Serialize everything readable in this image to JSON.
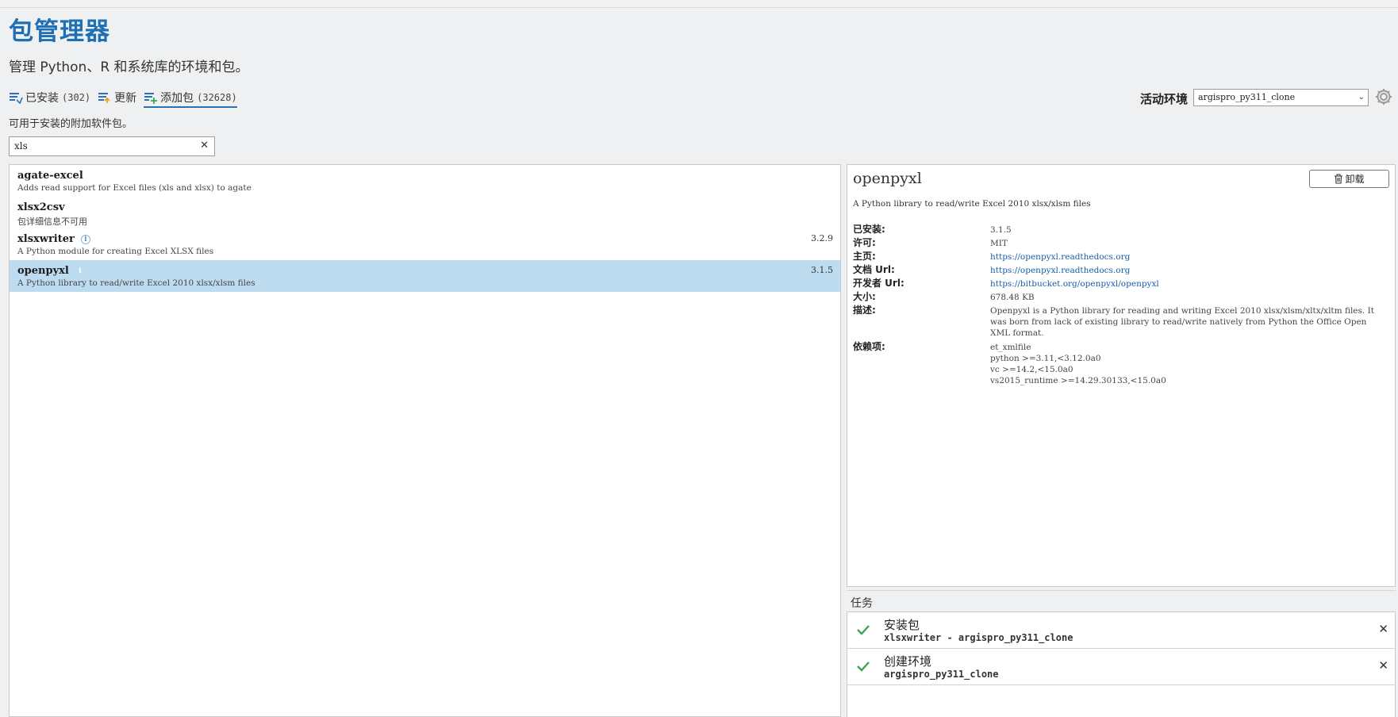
{
  "page": {
    "title": "包管理器",
    "subtitle": "管理 Python、R 和系统库的环境和包。"
  },
  "tabs": [
    {
      "label": "已安装",
      "count": "(302)",
      "icon": "installed-list-icon"
    },
    {
      "label": "更新",
      "count": "",
      "icon": "update-list-icon"
    },
    {
      "label": "添加包",
      "count": "(32628)",
      "icon": "add-package-icon",
      "active": true
    }
  ],
  "environment": {
    "label": "活动环境",
    "value": "argispro_py311_clone"
  },
  "hint": "可用于安装的附加软件包。",
  "search": {
    "value": "xls"
  },
  "packages": [
    {
      "name": "agate-excel",
      "description": "Adds read support for Excel files (xls and xlsx) to agate",
      "version": ""
    },
    {
      "name": "xlsx2csv",
      "description": "包详细信息不可用",
      "version": ""
    },
    {
      "name": "xlsxwriter",
      "description": "A Python module for creating Excel XLSX files",
      "version": "3.2.9"
    },
    {
      "name": "openpyxl",
      "description": "A Python library to read/write Excel 2010 xlsx/xlsm files",
      "version": "3.1.5"
    }
  ],
  "detail": {
    "name": "openpyxl",
    "uninstall_label": "卸载",
    "summary": "A Python library to read/write Excel 2010 xlsx/xlsm files",
    "installed_label": "已安装:",
    "installed": "3.1.5",
    "license_label": "许可:",
    "license": "MIT",
    "home_label": "主页:",
    "home": "https://openpyxl.readthedocs.org",
    "doc_label": "文档 Url:",
    "doc": "https://openpyxl.readthedocs.org",
    "dev_label": "开发者 Url:",
    "dev": "https://bitbucket.org/openpyxl/openpyxl",
    "size_label": "大小:",
    "size": "678.48 KB",
    "desc_label": "描述:",
    "desc": "Openpyxl is a Python library for reading and writing Excel 2010 xlsx/xlsm/xltx/xltm files. It was born from lack of existing library to read/write natively from Python the Office Open XML format.",
    "deps_label": "依赖项:",
    "deps": [
      "et_xmlfile",
      "python >=3.11,<3.12.0a0",
      "vc >=14.2,<15.0a0",
      "vs2015_runtime >=14.29.30133,<15.0a0"
    ]
  },
  "tasks": {
    "header": "任务",
    "items": [
      {
        "title": "安装包",
        "subtitle": "xlsxwriter - argispro_py311_clone"
      },
      {
        "title": "创建环境",
        "subtitle": "argispro_py311_clone"
      }
    ]
  },
  "colors": {
    "accent": "#1f6fb5",
    "selection": "#bddcf0",
    "success": "#3aa655"
  }
}
